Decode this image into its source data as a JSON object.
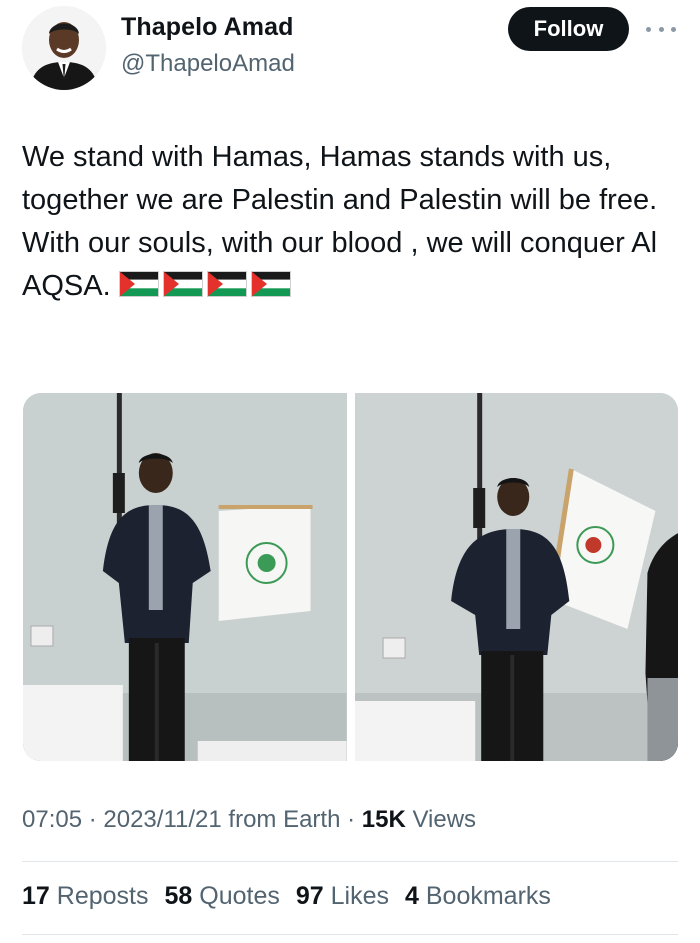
{
  "author": {
    "name": "Thapelo Amad",
    "handle": "@ThapeloAmad",
    "follow_label": "Follow"
  },
  "tweet": {
    "lines": [
      "We stand with Hamas, Hamas stands with us, together we are Palestin and Palestin will be free.",
      "With our souls, with our blood , we will conquer Al AQSA."
    ],
    "flag_emoji": [
      "palestine-flag",
      "palestine-flag",
      "palestine-flag",
      "palestine-flag"
    ]
  },
  "media": {
    "photos": [
      "photo-left",
      "photo-right"
    ]
  },
  "meta": {
    "time": "07:05",
    "sep1": " · ",
    "date": "2023/11/21",
    "source": " from Earth",
    "sep2": " · ",
    "views_count": "15K",
    "views_label": " Views"
  },
  "stats": [
    {
      "count": "17",
      "label": "Reposts"
    },
    {
      "count": "58",
      "label": "Quotes"
    },
    {
      "count": "97",
      "label": "Likes"
    },
    {
      "count": "4",
      "label": "Bookmarks"
    }
  ],
  "colors": {
    "text": "#0f1419",
    "secondary": "#536471",
    "button_bg": "#0f1419",
    "divider": "#e1e6ea"
  }
}
